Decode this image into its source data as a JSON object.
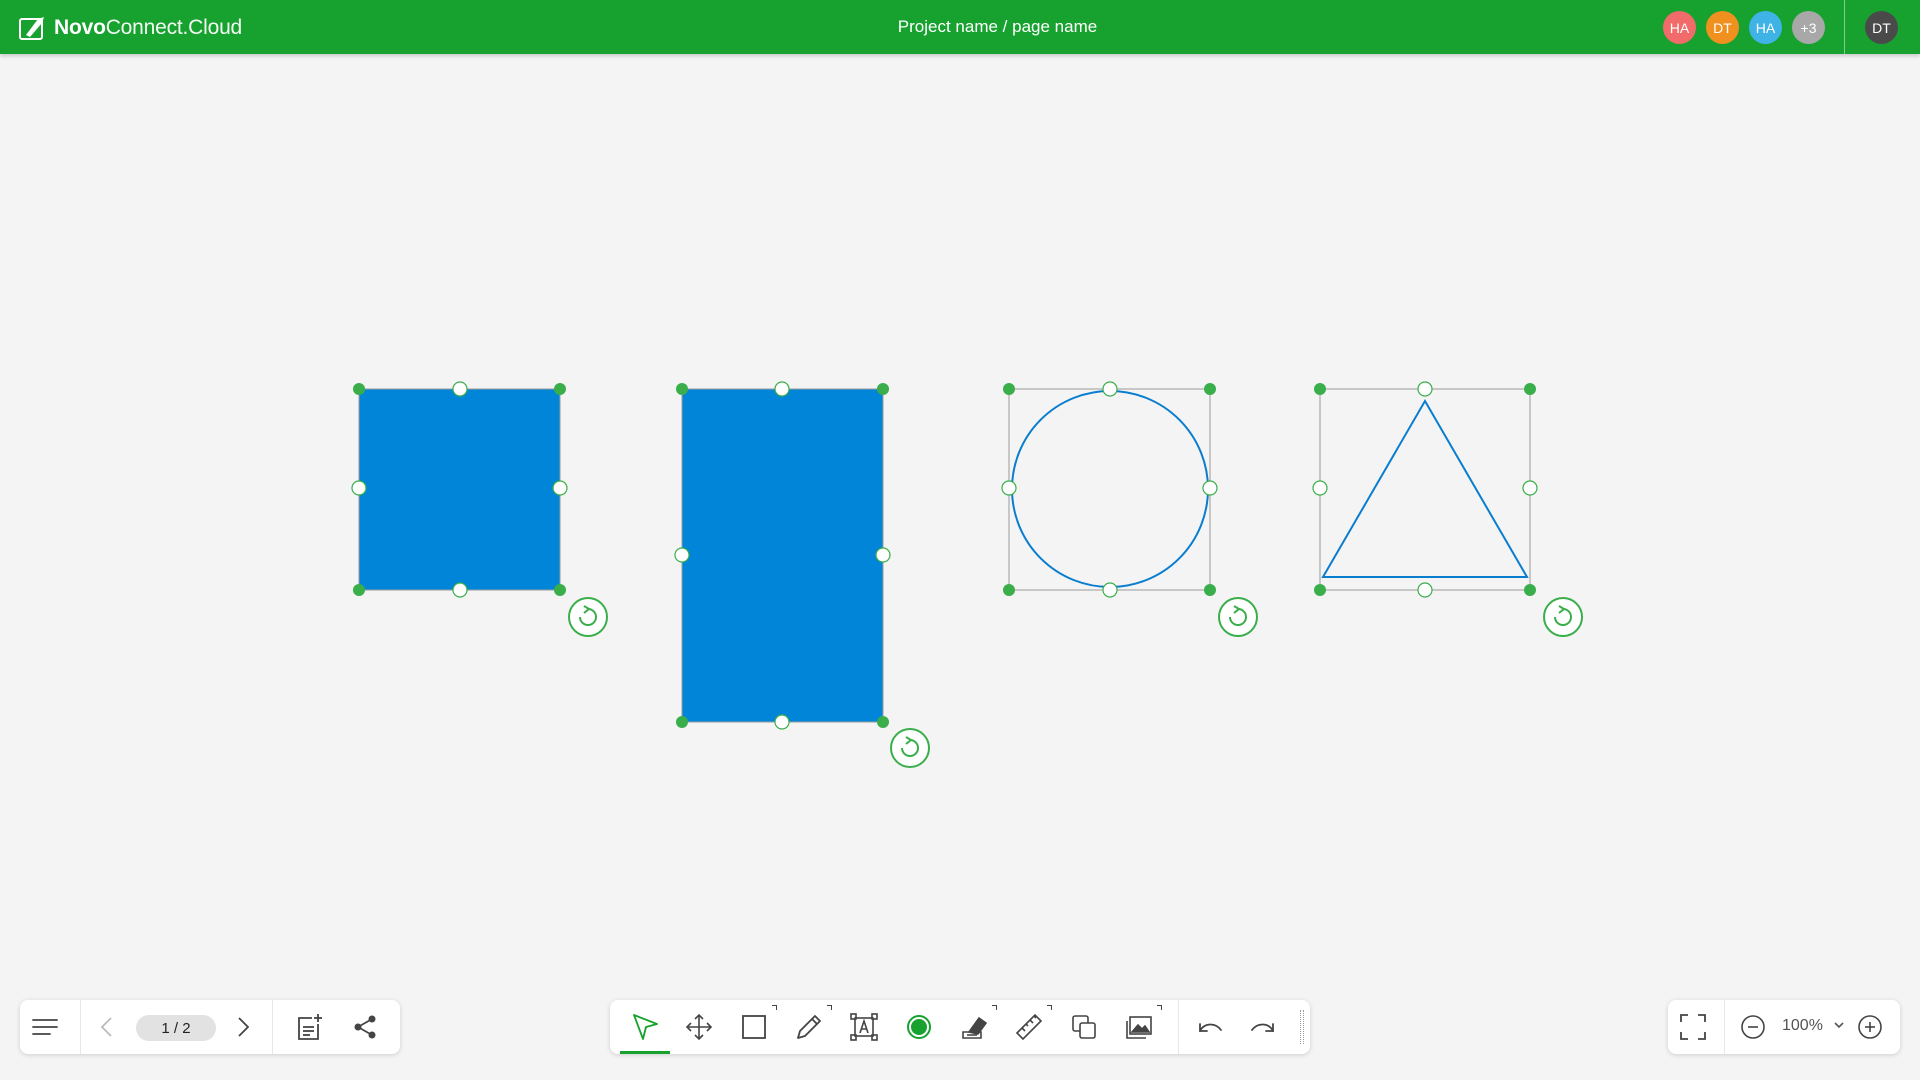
{
  "app": {
    "logo_bold": "Novo",
    "logo_light": "Connect.Cloud",
    "page_title": "Project name / page name",
    "brand_color": "#17a22f"
  },
  "header": {
    "participants": [
      {
        "initials": "HA",
        "color": "#f26b6b"
      },
      {
        "initials": "DT",
        "color": "#f0901e"
      },
      {
        "initials": "HA",
        "color": "#3fb3e6"
      },
      {
        "initials": "+3",
        "color": "#a8a8a8"
      }
    ],
    "current_user": {
      "initials": "DT",
      "color": "#4a4a4a"
    }
  },
  "canvas": {
    "shapes": [
      {
        "type": "square",
        "fill": "#0085d9"
      },
      {
        "type": "rectangle",
        "fill": "#0085d9"
      },
      {
        "type": "circle",
        "stroke": "#0a7dcf"
      },
      {
        "type": "triangle",
        "stroke": "#0a7dcf"
      }
    ]
  },
  "left_toolbar": {
    "menu_icon": "menu-icon",
    "prev_icon": "chevron-left-icon",
    "page_indicator": "1 / 2",
    "next_icon": "chevron-right-icon",
    "add_page_icon": "add-page-icon",
    "share_icon": "share-icon"
  },
  "main_toolbar": {
    "tools": [
      "select",
      "move",
      "shape",
      "pen",
      "text-box",
      "color",
      "eraser",
      "ruler",
      "duplicate",
      "image",
      "undo",
      "redo"
    ],
    "active_tool": "select"
  },
  "zoom_toolbar": {
    "fullscreen_icon": "fullscreen-icon",
    "zoom_out_icon": "zoom-out-icon",
    "zoom_level": "100%",
    "zoom_in_icon": "zoom-in-icon"
  }
}
